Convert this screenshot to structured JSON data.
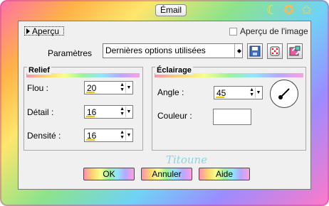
{
  "window": {
    "title": "Émail"
  },
  "header": {
    "preview_button": "Aperçu",
    "preview_check_label": "Aperçu de l'image",
    "params_label": "Paramètres",
    "preset_value": "Dernières options utilisées",
    "icons": [
      "save-icon",
      "random-dice-icon",
      "reset-icon"
    ]
  },
  "relief": {
    "title": "Relief",
    "rows": [
      {
        "label": "Flou :",
        "value": "20"
      },
      {
        "label": "Détail :",
        "value": "16"
      },
      {
        "label": "Densité :",
        "value": "16"
      }
    ]
  },
  "eclairage": {
    "title": "Éclairage",
    "angle_label": "Angle :",
    "angle_value": "45",
    "color_label": "Couleur :"
  },
  "signature": "Titoune",
  "buttons": {
    "ok": "OK",
    "cancel": "Annuler",
    "help": "Aide"
  },
  "colors": {
    "accent_underline": "#f2c400"
  }
}
